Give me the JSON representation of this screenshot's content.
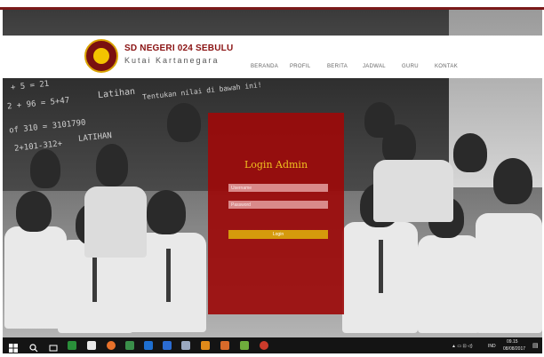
{
  "header": {
    "site_title": "SD NEGERI 024 SEBULU",
    "site_subtitle": "Kutai Kartanegara",
    "nav": [
      "BERANDA",
      "PROFIL",
      "BERITA",
      "JADWAL",
      "GURU",
      "KONTAK"
    ]
  },
  "login": {
    "title": "Login Admin",
    "username_placeholder": "Username",
    "password_placeholder": "Password",
    "button_label": "Login"
  },
  "chalkboard": {
    "lines": [
      "+ 5 = 21",
      "2 + 96 = 5+47",
      "of 310 = 3101790",
      "LATIHAN",
      "2+101-312+",
      "Latihan",
      "Tentukan nilai di bawah ini!"
    ]
  },
  "taskbar": {
    "tray_lang": "IND",
    "time": "09.15",
    "date": "08/08/2017"
  },
  "colors": {
    "brand_red": "#9c0a0a",
    "accent_gold": "#d59a0c",
    "title_gold": "#f0c020"
  }
}
